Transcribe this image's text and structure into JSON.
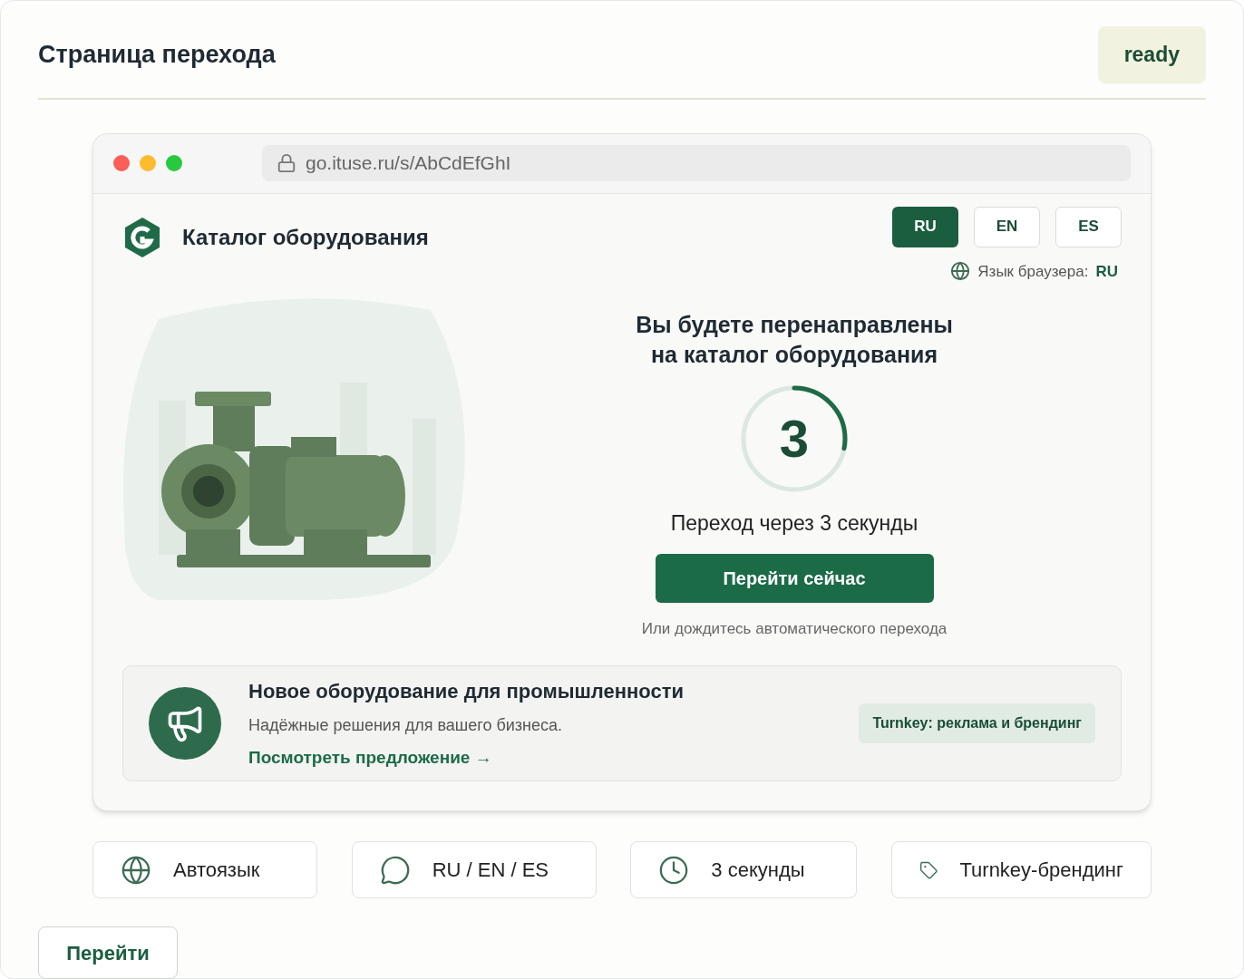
{
  "header": {
    "title": "Страница перехода",
    "status": "ready"
  },
  "browser": {
    "url": "go.ituse.ru/s/AbCdEfGhI"
  },
  "site": {
    "title": "Каталог оборудования",
    "languages": [
      {
        "label": "RU",
        "selected": true
      },
      {
        "label": "EN",
        "selected": false
      },
      {
        "label": "ES",
        "selected": false
      }
    ],
    "browser_language_label": "Язык браузера:",
    "browser_language_value": "RU"
  },
  "redirect": {
    "heading_line_1": "Вы будете перенаправлены",
    "heading_line_2": "на каталог оборудования",
    "countdown": "3",
    "level": 0.28,
    "timer_text": "Переход через 3 секунды",
    "go_now": "Перейти сейчас",
    "hint": "Или дождитесь автоматического перехода"
  },
  "promo": {
    "title": "Новое оборудование для промышленности",
    "subtitle": "Надёжные решения для вашего бизнеса.",
    "link": "Посмотреть предложение →",
    "tag": "Turnkey: реклама и брендинг"
  },
  "features": [
    {
      "label": "Автоязык"
    },
    {
      "label": "RU / EN / ES"
    },
    {
      "label": "3 секунды"
    },
    {
      "label": "Turnkey-брендинг"
    }
  ],
  "action_button": "Перейти"
}
